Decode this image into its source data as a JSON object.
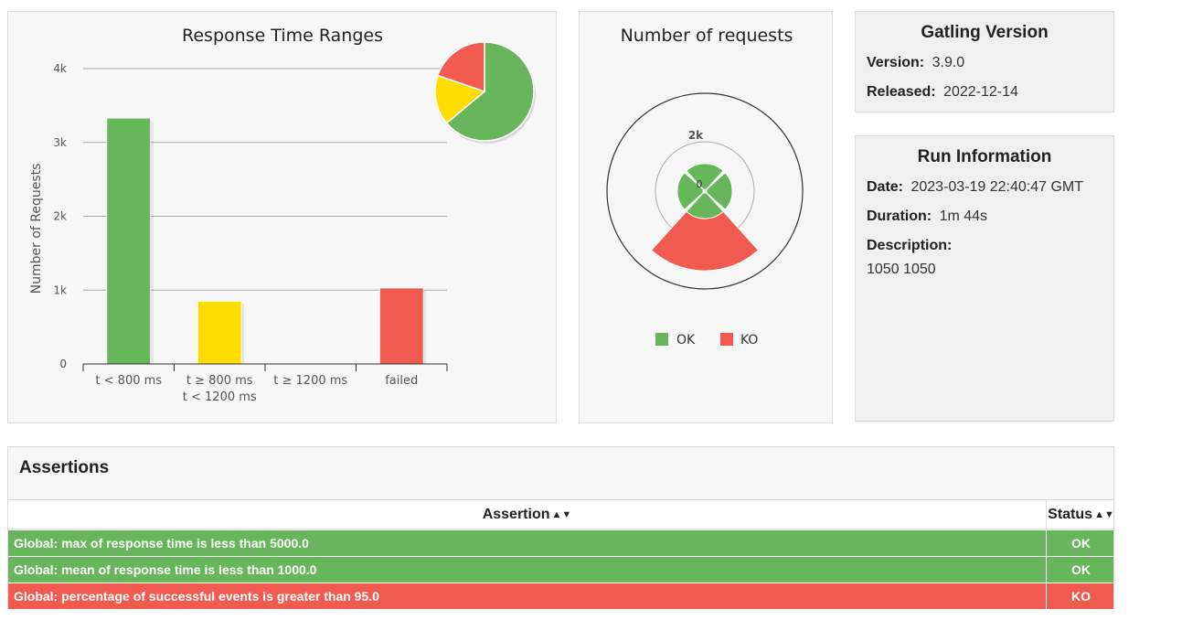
{
  "colors": {
    "ok": "#68b65c",
    "warn": "#ffdd00",
    "ko": "#f15b4f",
    "panel_bg": "#f7f7f7"
  },
  "response_time_ranges": {
    "title": "Response Time Ranges",
    "ylabel": "Number of Requests",
    "yticks": [
      "0",
      "1k",
      "2k",
      "3k",
      "4k"
    ],
    "categories": [
      {
        "line1": "t < 800 ms",
        "line2": ""
      },
      {
        "line1": "t ≥ 800 ms",
        "line2": "t < 1200 ms"
      },
      {
        "line1": "t ≥ 1200 ms",
        "line2": ""
      },
      {
        "line1": "failed",
        "line2": ""
      }
    ]
  },
  "number_of_requests": {
    "title": "Number of requests",
    "tick_outer": "2k",
    "tick_center": "0",
    "legend": [
      {
        "label": "OK",
        "color": "#68b65c"
      },
      {
        "label": "KO",
        "color": "#f15b4f"
      }
    ]
  },
  "gatling_version": {
    "title": "Gatling Version",
    "version_label": "Version:",
    "version_value": "3.9.0",
    "released_label": "Released:",
    "released_value": "2022-12-14"
  },
  "run_information": {
    "title": "Run Information",
    "date_label": "Date:",
    "date_value": "2023-03-19 22:40:47 GMT",
    "duration_label": "Duration:",
    "duration_value": "1m 44s",
    "description_label": "Description:",
    "description_value": "1050 1050"
  },
  "assertions": {
    "title": "Assertions",
    "column_assertion": "Assertion",
    "column_status": "Status",
    "sort_icon": "sort-icon",
    "rows": [
      {
        "text": "Global: max of response time is less than 5000.0",
        "status": "OK"
      },
      {
        "text": "Global: mean of response time is less than 1000.0",
        "status": "OK"
      },
      {
        "text": "Global: percentage of successful events is greater than 95.0",
        "status": "KO"
      }
    ]
  },
  "chart_data": [
    {
      "type": "bar",
      "title": "Response Time Ranges",
      "xlabel": "",
      "ylabel": "Number of Requests",
      "categories": [
        "t < 800 ms",
        "t ≥ 800 ms t < 1200 ms",
        "t ≥ 1200 ms",
        "failed"
      ],
      "values": [
        3330,
        850,
        0,
        1030
      ],
      "colors": [
        "#68b65c",
        "#ffdd00",
        "#68b65c",
        "#f15b4f"
      ],
      "ylim": [
        0,
        4000
      ],
      "grid": true,
      "legend": "none"
    },
    {
      "type": "pie",
      "title": "",
      "labels": [
        "t < 800 ms",
        "t ≥ 800 ms t < 1200 ms",
        "failed"
      ],
      "values": [
        3330,
        850,
        1030
      ],
      "colors": [
        "#68b65c",
        "#ffdd00",
        "#f15b4f"
      ],
      "placement": "top-right"
    },
    {
      "type": "polar",
      "title": "Number of requests",
      "series": [
        {
          "name": "OK",
          "values": [
            1000,
            1000,
            1000,
            1000
          ]
        },
        {
          "name": "KO",
          "values": [
            0,
            0,
            2100,
            0
          ]
        }
      ],
      "radial_max": 4000,
      "radial_ticks": [
        "0",
        "2k"
      ],
      "legend": "bottom"
    }
  ]
}
